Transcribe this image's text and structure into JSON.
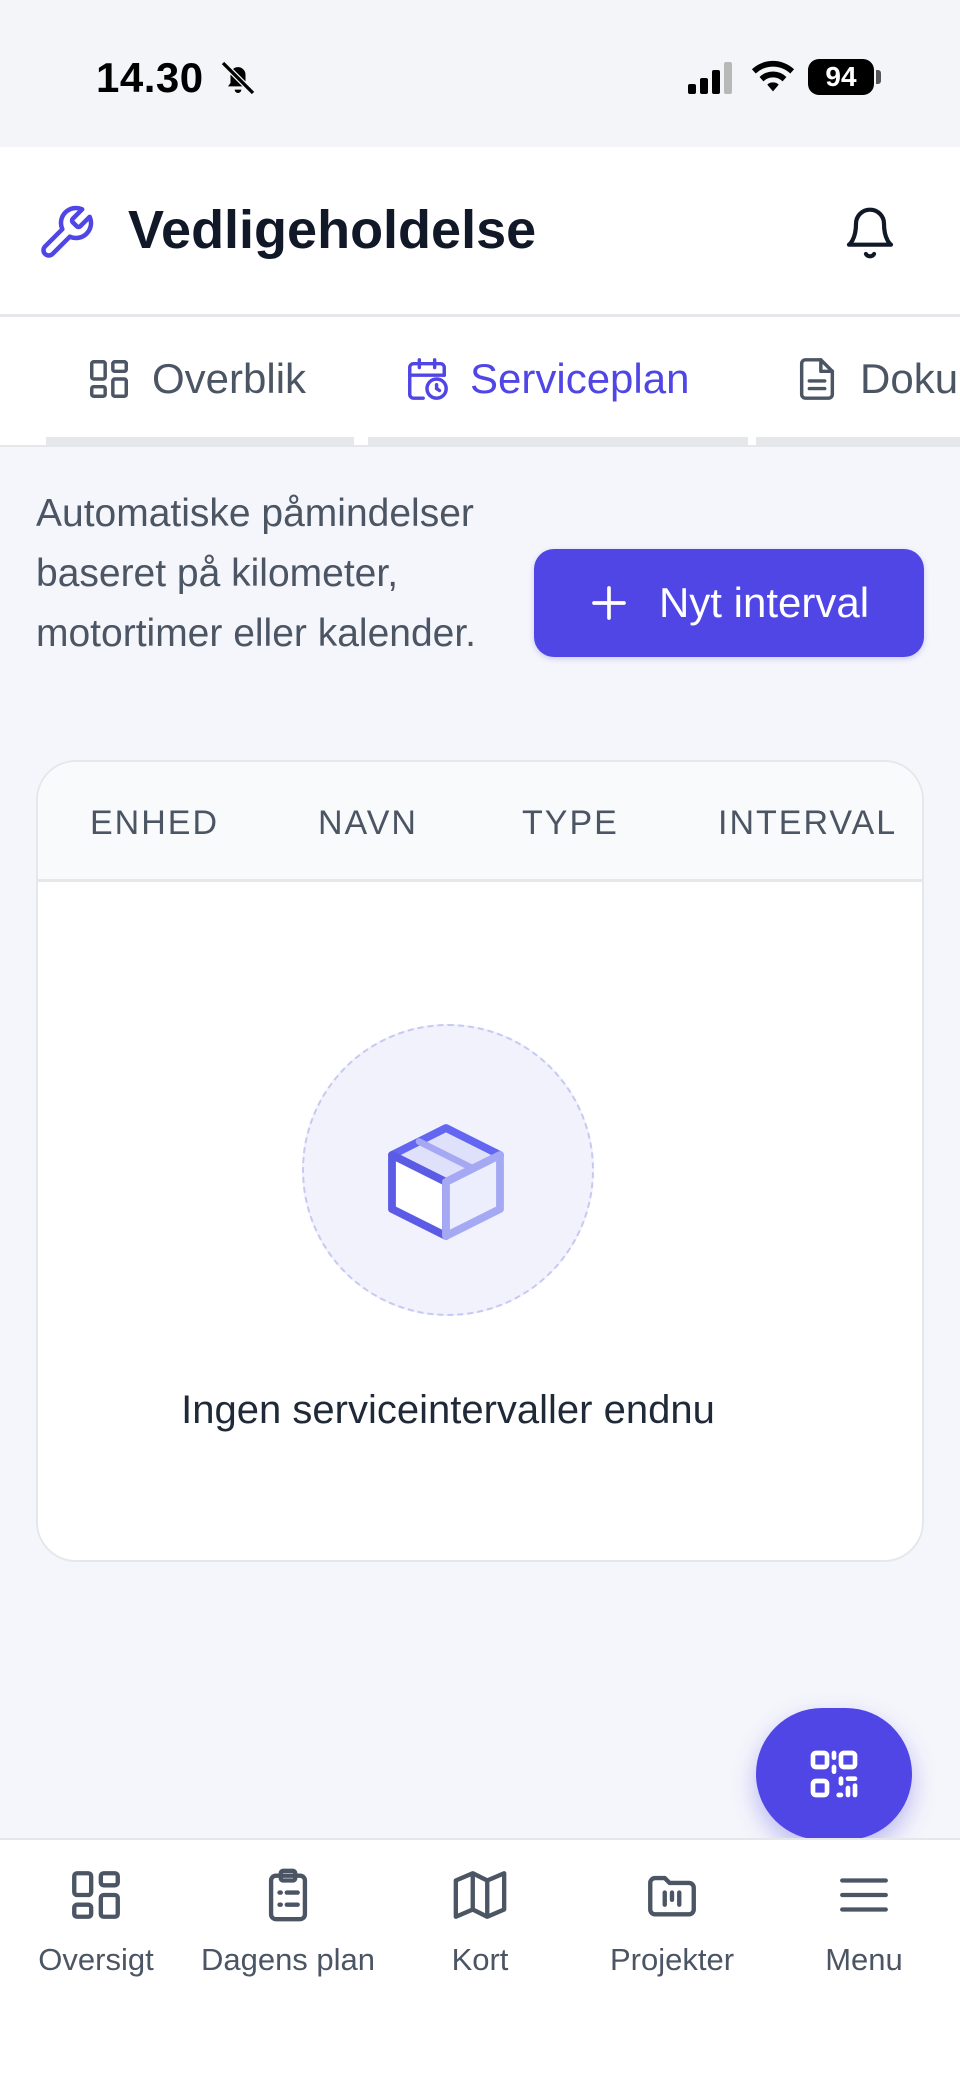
{
  "status_bar": {
    "time": "14.30",
    "battery": "94"
  },
  "header": {
    "title": "Vedligeholdelse"
  },
  "tabs": [
    {
      "label": "Overblik",
      "active": false
    },
    {
      "label": "Serviceplan",
      "active": true
    },
    {
      "label": "Doku",
      "active": false
    }
  ],
  "intro": {
    "text": "Automatiske påmindelser baseret på kilometer, motortimer eller kalender."
  },
  "new_interval_button": {
    "label": "Nyt interval"
  },
  "table": {
    "columns": [
      "ENHED",
      "NAVN",
      "TYPE",
      "INTERVAL"
    ],
    "empty_text": "Ingen serviceintervaller endnu"
  },
  "bottom_nav": [
    {
      "label": "Oversigt",
      "icon": "grid-icon"
    },
    {
      "label": "Dagens plan",
      "icon": "clipboard-icon"
    },
    {
      "label": "Kort",
      "icon": "map-icon"
    },
    {
      "label": "Projekter",
      "icon": "folder-icon"
    },
    {
      "label": "Menu",
      "icon": "menu-icon"
    }
  ],
  "colors": {
    "accent": "#4f46e5",
    "text_muted": "#4b5563",
    "background": "#f5f6fb"
  }
}
